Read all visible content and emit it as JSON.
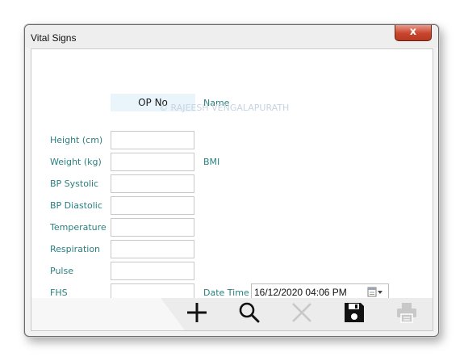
{
  "window": {
    "title": "Vital Signs",
    "close_label": "x"
  },
  "header": {
    "op_no_label": "OP No",
    "name_label": "Name",
    "watermark": "© RAJEESH VENGALAPURATH"
  },
  "fields": [
    {
      "label": "Height (cm)",
      "value": ""
    },
    {
      "label": "Weight (kg)",
      "value": ""
    },
    {
      "label": "BP Systolic",
      "value": ""
    },
    {
      "label": "BP Diastolic",
      "value": ""
    },
    {
      "label": "Temperature",
      "value": ""
    },
    {
      "label": "Respiration",
      "value": ""
    },
    {
      "label": "Pulse",
      "value": ""
    },
    {
      "label": "FHS",
      "value": ""
    }
  ],
  "bmi_label": "BMI",
  "datetime": {
    "label": "Date Time",
    "value": "16/12/2020 04:06 PM"
  },
  "toolbar": {
    "icons": [
      "add-icon",
      "search-icon",
      "clear-icon",
      "save-icon",
      "print-icon"
    ]
  },
  "colors": {
    "label_teal": "#2b8080",
    "close_red": "#c8432c",
    "icon_dark": "#111111",
    "icon_disabled": "#c8c8c8"
  }
}
